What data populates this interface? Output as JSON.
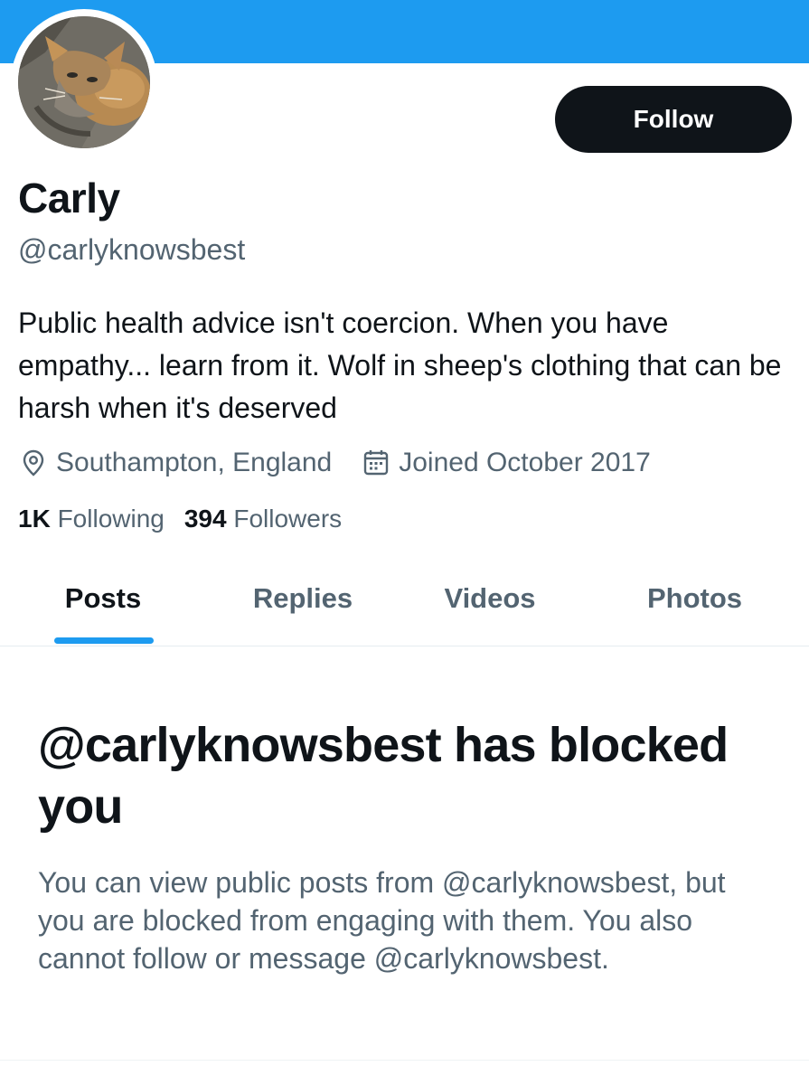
{
  "colors": {
    "banner": "#1d9bf0",
    "accent": "#1d9bf0",
    "text_primary": "#0f1419",
    "text_secondary": "#536471",
    "follow_button_bg": "#0f1419"
  },
  "profile": {
    "avatar_icon": "avatar-cat-photo",
    "follow_label": "Follow",
    "name": "Carly",
    "handle": "@carlyknowsbest",
    "bio": "Public health advice isn't coercion. When you have empathy... learn from it. Wolf in sheep's clothing that can be harsh when it's deserved",
    "location_icon": "location-pin-icon",
    "location": "Southampton, England",
    "joined_icon": "calendar-icon",
    "joined": "Joined October 2017",
    "following_count": "1K",
    "following_label": "Following",
    "followers_count": "394",
    "followers_label": "Followers"
  },
  "tabs": [
    {
      "label": "Posts",
      "active": true
    },
    {
      "label": "Replies",
      "active": false
    },
    {
      "label": "Videos",
      "active": false
    },
    {
      "label": "Photos",
      "active": false
    }
  ],
  "blocked_notice": {
    "title": "@carlyknowsbest has blocked you",
    "body": "You can view public posts from @carlyknowsbest, but you are blocked from engaging with them. You also cannot follow or message @carlyknowsbest."
  }
}
